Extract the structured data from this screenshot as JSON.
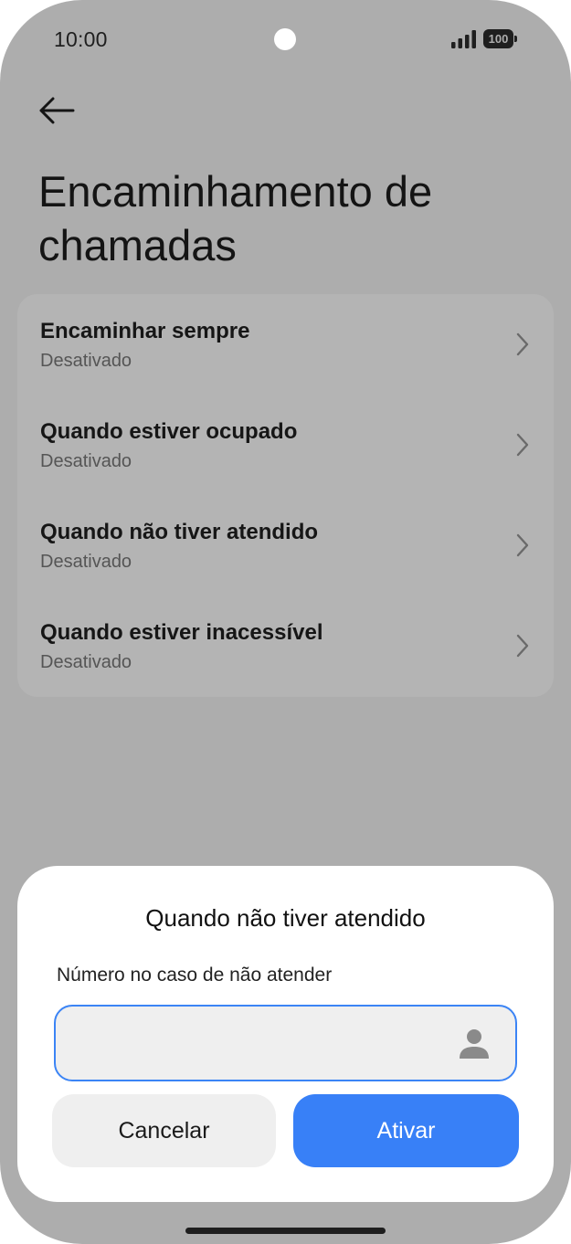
{
  "status_bar": {
    "time": "10:00",
    "battery": "100",
    "icons": [
      "signal-icon",
      "battery-icon"
    ]
  },
  "header": {
    "back_icon": "arrow-left-icon",
    "title": "Encaminhamento de chamadas"
  },
  "forwarding_options": [
    {
      "title": "Encaminhar sempre",
      "status": "Desativado"
    },
    {
      "title": "Quando estiver ocupado",
      "status": "Desativado"
    },
    {
      "title": "Quando não tiver atendido",
      "status": "Desativado"
    },
    {
      "title": "Quando estiver inacessível",
      "status": "Desativado"
    }
  ],
  "dialog": {
    "title": "Quando não tiver atendido",
    "field_label": "Número no caso de não atender",
    "input_value": "",
    "contact_icon": "person-icon",
    "cancel_label": "Cancelar",
    "confirm_label": "Ativar"
  },
  "colors": {
    "accent": "#3880f7",
    "scrim_background": "#adadad",
    "card_background": "#b4b4b4",
    "input_border": "#3b84f5"
  }
}
